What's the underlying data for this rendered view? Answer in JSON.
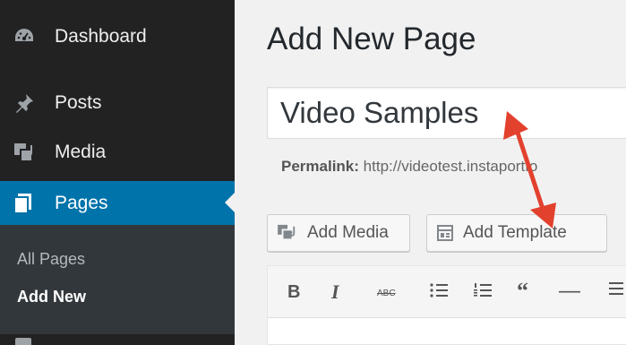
{
  "sidebar": {
    "items": [
      {
        "label": "Dashboard",
        "icon": "dashboard-icon"
      },
      {
        "label": "Posts",
        "icon": "pushpin-icon"
      },
      {
        "label": "Media",
        "icon": "media-icon"
      },
      {
        "label": "Pages",
        "icon": "pages-icon"
      }
    ],
    "submenu": {
      "all_pages": "All Pages",
      "add_new": "Add New"
    }
  },
  "main": {
    "title": "Add New Page",
    "title_input_value": "Video Samples",
    "permalink_label": "Permalink:",
    "permalink_url": "http://videotest.instaportfo",
    "buttons": {
      "add_media": "Add Media",
      "add_template": "Add Template"
    },
    "toolbar": {
      "bold": "B",
      "italic": "I",
      "strikethrough": "ABC",
      "quote": "“",
      "hr": "—"
    }
  },
  "colors": {
    "sidebar_bg": "#222222",
    "active_bg": "#0073aa",
    "submenu_bg": "#32373c",
    "annotation_arrow": "#e2412e"
  }
}
